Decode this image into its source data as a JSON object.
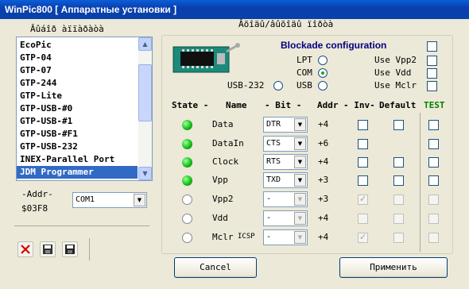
{
  "window": {
    "title": "WinPic800 [ Аппаратные установки ]"
  },
  "left": {
    "list_header": "Âûáîð àïïàðàòà",
    "programmers": [
      "EcoPic",
      "GTP-04",
      "GTP-07",
      "GTP-244",
      "GTP-Lite",
      "GTP-USB-#0",
      "GTP-USB-#1",
      "GTP-USB-#F1",
      "GTP-USB-232",
      "INEX-Parallel Port",
      "JDM Programmer"
    ],
    "selected": "JDM Programmer",
    "addr_label": "-Addr-",
    "addr_value": "$03F8",
    "port_value": "COM1"
  },
  "right": {
    "header": "Âõîäû/âûõîäû ïîðòà",
    "blockade_label": "Blockade configuration",
    "ports": {
      "lpt": "LPT",
      "com": "COM",
      "usb": "USB",
      "usb232": "USB-232",
      "selected": "COM"
    },
    "use": {
      "vpp2": "Use Vpp2",
      "vdd": "Use Vdd",
      "mclr": "Use Mclr"
    },
    "columns": {
      "state": "State -",
      "name": "Name",
      "bit": "- Bit -",
      "addr": "Addr",
      "inv": "- Inv-",
      "default": "Default",
      "test": "TEST"
    },
    "rows": [
      {
        "name": "Data",
        "bit": "DTR",
        "addr": "+4",
        "led": "on",
        "enabled": true,
        "inv": false,
        "has_default": true
      },
      {
        "name": "DataIn",
        "bit": "CTS",
        "addr": "+6",
        "led": "on",
        "enabled": true,
        "inv": false,
        "has_default": false
      },
      {
        "name": "Clock",
        "bit": "RTS",
        "addr": "+4",
        "led": "on",
        "enabled": true,
        "inv": false,
        "has_default": true
      },
      {
        "name": "Vpp",
        "bit": "TXD",
        "addr": "+3",
        "led": "on",
        "enabled": true,
        "inv": false,
        "has_default": true
      },
      {
        "name": "Vpp2",
        "bit": "-",
        "addr": "+3",
        "led": "off",
        "enabled": false,
        "inv": true,
        "has_default": true
      },
      {
        "name": "Vdd",
        "bit": "-",
        "addr": "+4",
        "led": "off",
        "enabled": false,
        "inv": false,
        "has_default": true
      },
      {
        "name": "Mclr",
        "bit": "-",
        "addr": "+4",
        "led": "off",
        "enabled": false,
        "inv": true,
        "has_default": true
      }
    ],
    "icsp": "ICSP"
  },
  "buttons": {
    "cancel": "Cancel",
    "apply": "Применить"
  },
  "colors": {
    "test_green": "#008000",
    "blockade_blue": "#000080",
    "selection": "#316ac5"
  }
}
